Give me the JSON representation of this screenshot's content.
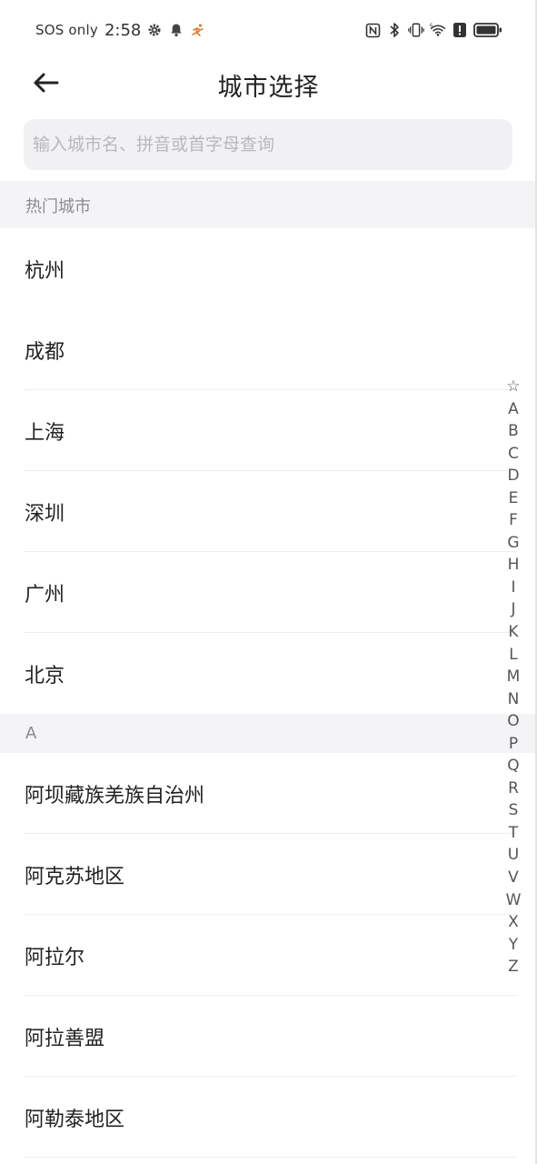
{
  "status_bar": {
    "carrier": "SOS only",
    "time": "2:58",
    "left_icons": [
      "gear-icon",
      "bell-icon",
      "runner-icon"
    ],
    "right_icons": [
      "nfc-icon",
      "bluetooth-icon",
      "vibrate-icon",
      "wifi-icon",
      "alert-icon",
      "battery-icon"
    ],
    "accent_runner": "#e07a2e"
  },
  "header": {
    "title": "城市选择",
    "back_icon": "arrow-left-icon"
  },
  "search": {
    "placeholder": "输入城市名、拼音或首字母查询",
    "value": ""
  },
  "hot_section": {
    "label": "热门城市",
    "cities": [
      "杭州",
      "成都",
      "上海",
      "深圳",
      "广州",
      "北京"
    ]
  },
  "alpha_section": {
    "label": "A",
    "cities": [
      "阿坝藏族羌族自治州",
      "阿克苏地区",
      "阿拉尔",
      "阿拉善盟",
      "阿勒泰地区"
    ]
  },
  "alphabet_index": [
    "☆",
    "A",
    "B",
    "C",
    "D",
    "E",
    "F",
    "G",
    "H",
    "I",
    "J",
    "K",
    "L",
    "M",
    "N",
    "O",
    "P",
    "Q",
    "R",
    "S",
    "T",
    "U",
    "V",
    "W",
    "X",
    "Y",
    "Z"
  ],
  "colors": {
    "section_bg": "#f4f4f6",
    "search_bg": "#f1f1f3",
    "placeholder": "#b9b9bd",
    "text": "#222222"
  }
}
